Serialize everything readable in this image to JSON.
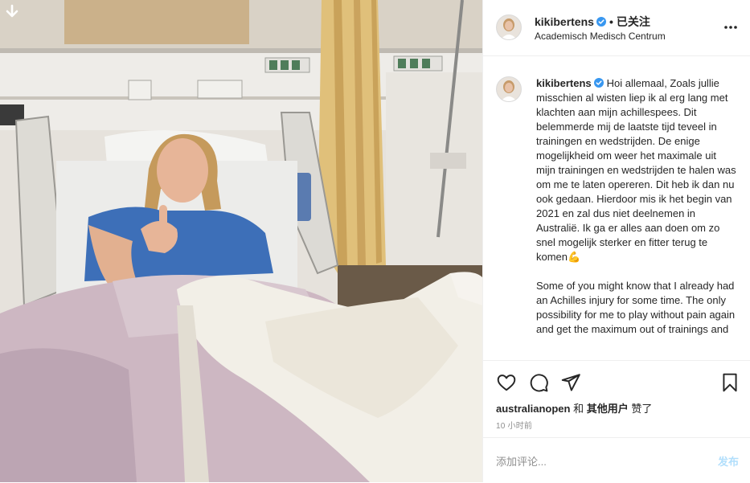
{
  "post": {
    "username": "kikibertens",
    "follow_label": "已关注",
    "dot": "•",
    "location": "Academisch Medisch Centrum",
    "caption_paragraphs": [
      "Hoi allemaal, Zoals jullie misschien al wisten liep ik al erg lang met klachten aan mijn achillespees. Dit belemmerde mij de laatste tijd teveel in trainingen en wedstrijden. De enige mogelijkheid om weer het maximale uit mijn trainingen en wedstrijden te halen was om me te laten opereren. Dit heb ik dan nu ook gedaan. Hierdoor mis ik het begin van 2021 en zal dus niet deelnemen in Australië. Ik ga er alles aan doen om zo snel mogelijk sterker en fitter terug te komen💪",
      "Some of you might know that I already had an Achilles injury for some time. The only possibility for me to play without pain again and get the maximum out of trainings and"
    ],
    "likes": {
      "user": "australianopen",
      "and": "和",
      "others": "其他用户",
      "liked": "赞了"
    },
    "time_ago": "10 小时前"
  },
  "comment": {
    "placeholder": "添加评论...",
    "post_label": "发布"
  },
  "icons": {
    "download": "download-arrow-icon",
    "more": "more-options-icon",
    "like": "heart-icon",
    "comment": "comment-bubble-icon",
    "share": "paper-plane-icon",
    "save": "bookmark-icon",
    "verified": "verified-badge-icon"
  },
  "colors": {
    "verified": "#3897f0",
    "text": "#262626",
    "muted": "#8e8e8e",
    "post_disabled": "#b2dffc",
    "border": "#efefef"
  }
}
